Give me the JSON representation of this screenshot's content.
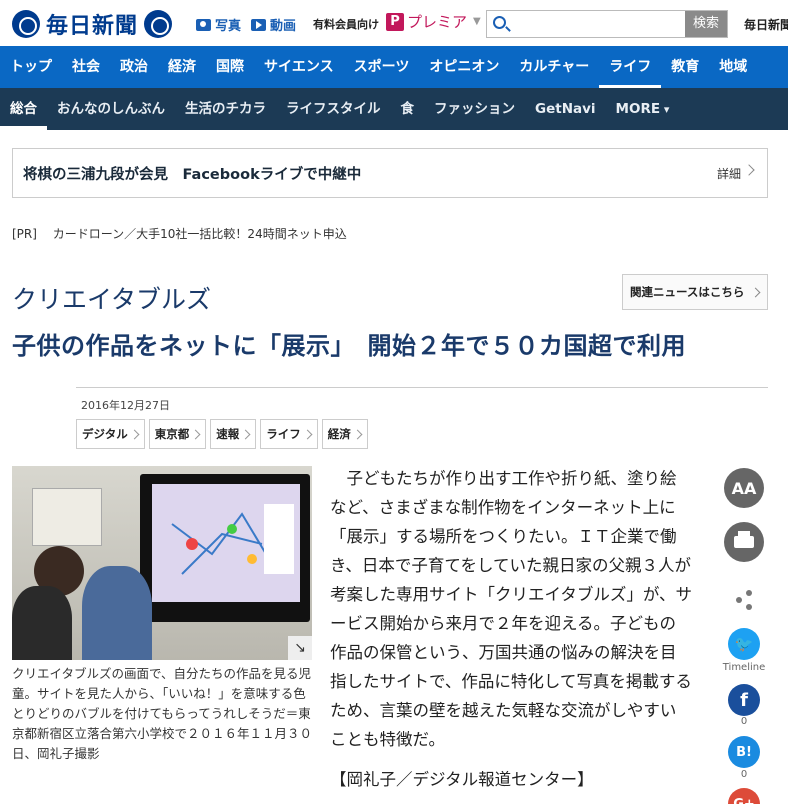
{
  "header": {
    "logo_text": "毎日新聞",
    "photo_label": "写真",
    "video_label": "動画",
    "member_label": "有料会員向け",
    "premier_label": "プレミア",
    "search_placeholder": "",
    "search_button": "検索",
    "top_right": "毎日新聞"
  },
  "nav_primary": [
    "トップ",
    "社会",
    "政治",
    "経済",
    "国際",
    "サイエンス",
    "スポーツ",
    "オピニオン",
    "カルチャー",
    "ライフ",
    "教育",
    "地域"
  ],
  "nav_primary_active": "ライフ",
  "nav_secondary": [
    "総合",
    "おんなのしんぶん",
    "生活のチカラ",
    "ライフスタイル",
    "食",
    "ファッション",
    "GetNavi",
    "MORE"
  ],
  "nav_secondary_active": "総合",
  "banner": {
    "text": "将棋の三浦九段が会見　Facebookライブで中継中",
    "detail": "詳細"
  },
  "pr": {
    "tag": "[PR]",
    "text": "カードローン／大手10社一括比較！24時間ネット申込"
  },
  "article": {
    "kicker": "クリエイタブルズ",
    "title": "子供の作品をネットに「展示」　開始２年で５０カ国超で利用",
    "related_button": "関連ニュースはこちら",
    "date": "2016年12月27日",
    "tags": [
      "デジタル",
      "東京都",
      "速報",
      "ライフ",
      "経済"
    ],
    "caption": "クリエイタブルズの画面で、自分たちの作品を見る児童。サイトを見た人から、「いいね！」を意味する色とりどりのバブルを付けてもらってうれしそうだ＝東京都新宿区立落合第六小学校で２０１６年１１月３０日、岡礼子撮影",
    "body": "子どもたちが作り出す工作や折り紙、塗り絵など、さまざまな制作物をインターネット上に「展示」する場所をつくりたい。ＩＴ企業で働き、日本で子育てをしていた親日家の父親３人が考案した専用サイト「クリエイタブルズ」が、サービス開始から来月で２年を迎える。子どもの作品の保管という、万国共通の悩みの解決を目指したサイトで、作品に特化して写真を掲載するため、言葉の壁を越えた気軽な交流がしやすいことも特徴だ。",
    "byline": "【岡礼子／デジタル報道センター】"
  },
  "tools": {
    "font_size": "AA",
    "twitter_label": "Timeline",
    "facebook_count": "0",
    "hatena_label": "B!",
    "hatena_count": "0"
  },
  "colors": {
    "nav_primary_bg": "#0a68c4",
    "nav_secondary_bg": "#1c3a55",
    "title": "#1a3a6a"
  }
}
